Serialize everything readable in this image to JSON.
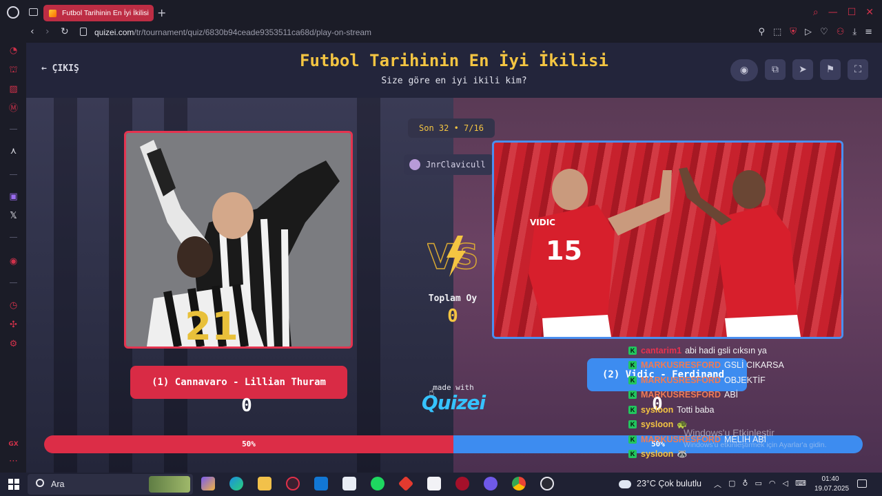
{
  "browser": {
    "tab_title": "Futbol Tarihinin En İyi İkilisi",
    "new_tab": "+",
    "url_domain": "quizei.com",
    "url_path": "/tr/tournament/quiz/6830b94ceade9353511ca68d/play-on-stream"
  },
  "header": {
    "back_label": "ÇIKIŞ",
    "title": "Futbol Tarihinin En İyi İkilisi",
    "subtitle": "Size göre en iyi ikili kim?"
  },
  "round": {
    "label": "Son 32 • 7/16"
  },
  "streamer": {
    "name": "JnrClavicull"
  },
  "left": {
    "name": "(1) Cannavaro - Lillian Thuram",
    "votes": "0",
    "percent_label": "50%",
    "percent": 50,
    "color": "#dc2d47"
  },
  "right": {
    "name": "(2) Vidic - Ferdinand",
    "votes": "0",
    "percent_label": "50%",
    "percent": 50,
    "color": "#3d8cf0"
  },
  "center": {
    "total_label": "Toplam Oy",
    "total_value": "0",
    "made_with": "made with",
    "brand": "Quizei"
  },
  "chat": [
    {
      "user": "cantarim1",
      "msg": "abi hadi gsli cıksın ya",
      "color": "#e8334f"
    },
    {
      "user": "MARKUSRESFORD",
      "msg": "GSLİ CIKARSA",
      "color": "#f07a54"
    },
    {
      "user": "MARKUSRESFORD",
      "msg": "OBJEKTİF",
      "color": "#f07a54"
    },
    {
      "user": "MARKUSRESFORD",
      "msg": "ABİ",
      "color": "#f07a54"
    },
    {
      "user": "sysloon",
      "msg": "Totti baba",
      "color": "#f4c542"
    },
    {
      "user": "sysloon",
      "msg": "🐢",
      "color": "#f4c542"
    },
    {
      "user": "MARKUSRESFORD",
      "msg": "MELİH ABİ",
      "color": "#f07a54"
    },
    {
      "user": "sysloon",
      "msg": "🦝",
      "color": "#f4c542"
    }
  ],
  "windows_activation": {
    "title": "Windows'u Etkinleştir",
    "subtitle": "Windows'u etkinleştirmek için Ayarlar'a gidin."
  },
  "taskbar": {
    "search_placeholder": "Ara",
    "weather": "23°C  Çok bulutlu",
    "time": "01:40",
    "date": "19.07.2025"
  }
}
